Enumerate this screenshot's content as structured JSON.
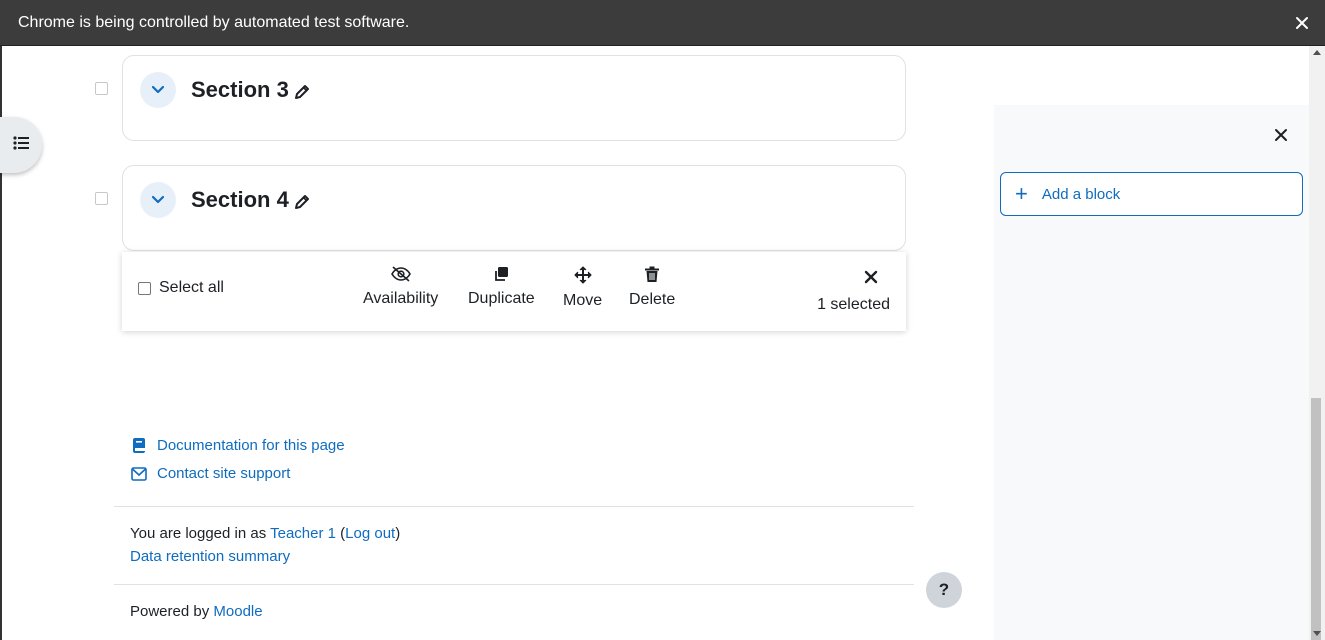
{
  "browser": {
    "infobar_text": "Chrome is being controlled by automated test software."
  },
  "sections": [
    {
      "title": "Section 3"
    },
    {
      "title": "Section 4"
    }
  ],
  "bulk_edit": {
    "select_all_label": "Select all",
    "actions": {
      "availability": "Availability",
      "duplicate": "Duplicate",
      "move": "Move",
      "delete": "Delete"
    },
    "selected_count": "1 selected"
  },
  "footer": {
    "documentation_link": "Documentation for this page",
    "support_link": "Contact site support",
    "logged_in_prefix": "You are logged in as ",
    "user_name": "Teacher 1",
    "logout_open": " (",
    "logout_link": "Log out",
    "logout_close": ")",
    "data_retention_link": "Data retention summary",
    "powered_by_prefix": "Powered by ",
    "moodle_link": "Moodle",
    "help_button": "?"
  },
  "block_drawer": {
    "add_block_label": "Add a block"
  },
  "colors": {
    "link": "#0f6cbf",
    "infobar_bg": "#3c3c3c",
    "drawer_bg": "#f8f9fa"
  }
}
